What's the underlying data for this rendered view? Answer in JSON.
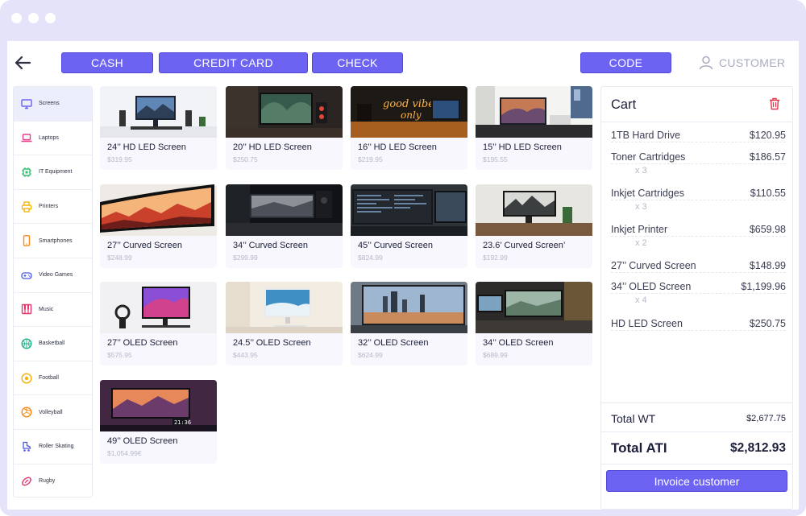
{
  "toolbar": {
    "back_icon": "arrow-left-icon",
    "cash_label": "CASH",
    "credit_card_label": "CREDIT CARD",
    "check_label": "CHECK",
    "code_label": "CODE",
    "customer_label": "CUSTOMER"
  },
  "categories": [
    {
      "label": "Screens",
      "icon": "monitor-icon",
      "color": "#6c63f3",
      "active": true
    },
    {
      "label": "Laptops",
      "icon": "laptop-icon",
      "color": "#e83e8c"
    },
    {
      "label": "IT Equipment",
      "icon": "chip-icon",
      "color": "#2fbf71"
    },
    {
      "label": "Printers",
      "icon": "printer-icon",
      "color": "#f6b100"
    },
    {
      "label": "Smartphones",
      "icon": "smartphone-icon",
      "color": "#f98a1a"
    },
    {
      "label": "Video Games",
      "icon": "gamepad-icon",
      "color": "#4a57e8"
    },
    {
      "label": "Music",
      "icon": "piano-icon",
      "color": "#e8336a"
    },
    {
      "label": "Basketball",
      "icon": "basketball-icon",
      "color": "#21b38a"
    },
    {
      "label": "Football",
      "icon": "football-icon",
      "color": "#f6b100"
    },
    {
      "label": "Volleyball",
      "icon": "volleyball-icon",
      "color": "#f98a1a"
    },
    {
      "label": "Roller Skating",
      "icon": "roller-skate-icon",
      "color": "#4a57e8"
    },
    {
      "label": "Rugby",
      "icon": "rugby-ball-icon",
      "color": "#e8336a"
    }
  ],
  "products": [
    {
      "name": "24’’ HD LED Screen",
      "price": "$319.95"
    },
    {
      "name": "20’’ HD LED Screen",
      "price": "$250.75"
    },
    {
      "name": "16’’ HD LED Screen",
      "price": "$219.95"
    },
    {
      "name": "15’’ HD LED Screen",
      "price": "$195.55"
    },
    {
      "name": "27’’ Curved Screen",
      "price": "$248.99"
    },
    {
      "name": "34’’ Curved Screen",
      "price": "$299.99"
    },
    {
      "name": "45’’ Curved Screen",
      "price": "$824.99"
    },
    {
      "name": "23.6’ Curved Screen’",
      "price": "$192.99"
    },
    {
      "name": "27’’ OLED Screen",
      "price": "$575.95"
    },
    {
      "name": "24.5’’ OLED Screen",
      "price": "$443.95"
    },
    {
      "name": "32’’ OLED Screen",
      "price": "$624.99"
    },
    {
      "name": "34’’ OLED Screen",
      "price": "$689.99"
    },
    {
      "name": "49’’ OLED Screen",
      "price": "$1,054.99€"
    }
  ],
  "cart": {
    "title": "Cart",
    "trash_icon": "trash-icon",
    "items": [
      {
        "name": "1TB Hard Drive",
        "price": "$120.95"
      },
      {
        "name": "Toner Cartridges",
        "price": "$186.57",
        "qty": "x 3"
      },
      {
        "name": "Inkjet Cartridges",
        "price": "$110.55",
        "qty": "x 3"
      },
      {
        "name": "Inkjet Printer",
        "price": "$659.98",
        "qty": "x 2"
      },
      {
        "name": "27’’ Curved Screen",
        "price": "$148.99"
      },
      {
        "name": "34’’ OLED Screen",
        "price": "$1,199.96",
        "qty": "x 4"
      },
      {
        "name": "HD LED Screen",
        "price": "$250.75"
      }
    ],
    "total_wt_label": "Total WT",
    "total_wt_value": "$2,677.75",
    "total_ati_label": "Total ATI",
    "total_ati_value": "$2,812.93",
    "invoice_label": "Invoice customer"
  },
  "colors": {
    "accent": "#6c63f3",
    "frame": "#e4e3f9",
    "card_bg": "#f7f7fd",
    "trash": "#e0364c"
  }
}
